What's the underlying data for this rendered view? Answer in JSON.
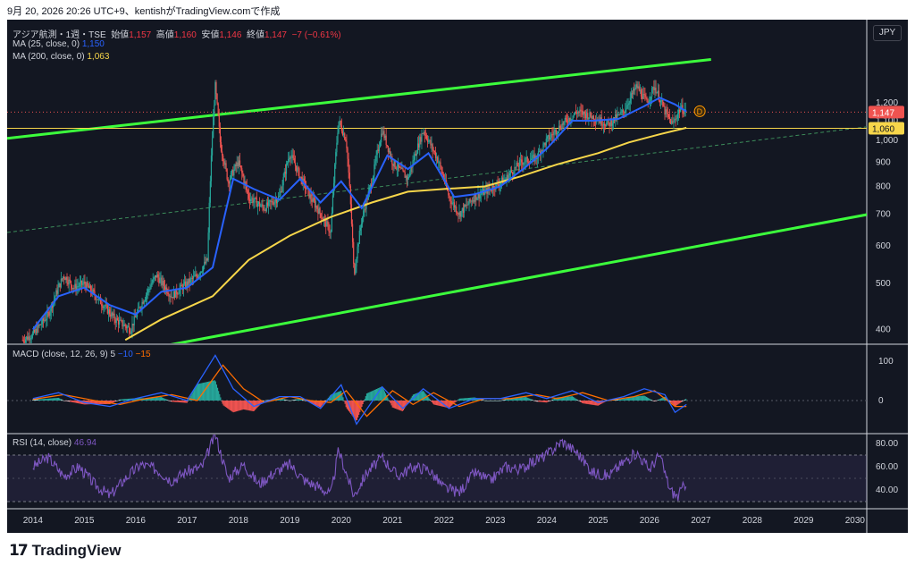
{
  "header": {
    "timestamp_text": "9月 20, 2026 20:26 UTC+9、kentishがTradingView.comで作成"
  },
  "symbol": {
    "name": "アジア航測・1週・TSE",
    "open_label": "始値",
    "open": "1,157",
    "high_label": "高値",
    "high": "1,160",
    "low_label": "安値",
    "low": "1,146",
    "close_label": "終値",
    "close": "1,147",
    "change": "−7 (−0.61%)"
  },
  "legend": {
    "ma25_label": "MA (25, close, 0)",
    "ma25_value": "1,150",
    "ma200_label": "MA (200, close, 0)",
    "ma200_value": "1,063",
    "macd_label": "MACD (close, 12, 26, 9)",
    "macd_hist": "5",
    "macd_line": "−10",
    "macd_signal": "−15",
    "rsi_label": "RSI (14, close)",
    "rsi_value": "46.94"
  },
  "currency_button": "JPY",
  "price_tags": {
    "last": "1,147",
    "ma200": "1,060"
  },
  "event_marker": "D",
  "colors": {
    "background": "#131722",
    "up": "#26a69a",
    "down": "#ef5350",
    "ma25": "#2962ff",
    "ma200": "#f7d64a",
    "channel": "#3cff3c",
    "macd": "#2962ff",
    "signal": "#ff6d00",
    "rsi": "#7e57c2"
  },
  "chart_data": {
    "type": "candlestick",
    "x_ticks": [
      "2014",
      "2015",
      "2016",
      "2017",
      "2018",
      "2019",
      "2020",
      "2021",
      "2022",
      "2023",
      "2024",
      "2025",
      "2026",
      "2027",
      "2028",
      "2029",
      "2030"
    ],
    "y_ticks": [
      "1,200",
      "1,100",
      "1,000",
      "900",
      "800",
      "700",
      "600",
      "500",
      "400"
    ],
    "y_scale": "log",
    "price_series": [
      {
        "t": 2013.8,
        "p": 380
      },
      {
        "t": 2014.0,
        "p": 390
      },
      {
        "t": 2014.3,
        "p": 430
      },
      {
        "t": 2014.6,
        "p": 520
      },
      {
        "t": 2014.8,
        "p": 490
      },
      {
        "t": 2015.0,
        "p": 500
      },
      {
        "t": 2015.3,
        "p": 460
      },
      {
        "t": 2015.6,
        "p": 420
      },
      {
        "t": 2015.9,
        "p": 400
      },
      {
        "t": 2016.1,
        "p": 450
      },
      {
        "t": 2016.4,
        "p": 520
      },
      {
        "t": 2016.7,
        "p": 470
      },
      {
        "t": 2016.9,
        "p": 490
      },
      {
        "t": 2017.2,
        "p": 520
      },
      {
        "t": 2017.4,
        "p": 560
      },
      {
        "t": 2017.55,
        "p": 1300
      },
      {
        "t": 2017.65,
        "p": 980
      },
      {
        "t": 2017.8,
        "p": 820
      },
      {
        "t": 2018.0,
        "p": 900
      },
      {
        "t": 2018.2,
        "p": 760
      },
      {
        "t": 2018.5,
        "p": 720
      },
      {
        "t": 2018.8,
        "p": 760
      },
      {
        "t": 2019.0,
        "p": 940
      },
      {
        "t": 2019.2,
        "p": 840
      },
      {
        "t": 2019.4,
        "p": 760
      },
      {
        "t": 2019.6,
        "p": 700
      },
      {
        "t": 2019.8,
        "p": 640
      },
      {
        "t": 2019.95,
        "p": 1100
      },
      {
        "t": 2020.1,
        "p": 1000
      },
      {
        "t": 2020.25,
        "p": 520
      },
      {
        "t": 2020.4,
        "p": 680
      },
      {
        "t": 2020.6,
        "p": 820
      },
      {
        "t": 2020.8,
        "p": 1050
      },
      {
        "t": 2021.0,
        "p": 900
      },
      {
        "t": 2021.3,
        "p": 830
      },
      {
        "t": 2021.6,
        "p": 1050
      },
      {
        "t": 2021.9,
        "p": 900
      },
      {
        "t": 2022.1,
        "p": 760
      },
      {
        "t": 2022.3,
        "p": 700
      },
      {
        "t": 2022.6,
        "p": 760
      },
      {
        "t": 2022.9,
        "p": 790
      },
      {
        "t": 2023.2,
        "p": 830
      },
      {
        "t": 2023.5,
        "p": 900
      },
      {
        "t": 2023.8,
        "p": 920
      },
      {
        "t": 2024.0,
        "p": 1000
      },
      {
        "t": 2024.3,
        "p": 1080
      },
      {
        "t": 2024.6,
        "p": 1150
      },
      {
        "t": 2024.9,
        "p": 1120
      },
      {
        "t": 2025.2,
        "p": 1080
      },
      {
        "t": 2025.5,
        "p": 1150
      },
      {
        "t": 2025.75,
        "p": 1300
      },
      {
        "t": 2025.95,
        "p": 1200
      },
      {
        "t": 2026.1,
        "p": 1300
      },
      {
        "t": 2026.3,
        "p": 1150
      },
      {
        "t": 2026.45,
        "p": 1080
      },
      {
        "t": 2026.6,
        "p": 1170
      },
      {
        "t": 2026.72,
        "p": 1147
      }
    ],
    "ma25_series": [
      {
        "t": 2014.0,
        "p": 400
      },
      {
        "t": 2014.5,
        "p": 470
      },
      {
        "t": 2015.0,
        "p": 490
      },
      {
        "t": 2015.5,
        "p": 450
      },
      {
        "t": 2016.0,
        "p": 430
      },
      {
        "t": 2016.5,
        "p": 480
      },
      {
        "t": 2017.0,
        "p": 490
      },
      {
        "t": 2017.5,
        "p": 540
      },
      {
        "t": 2017.9,
        "p": 830
      },
      {
        "t": 2018.3,
        "p": 790
      },
      {
        "t": 2018.8,
        "p": 750
      },
      {
        "t": 2019.2,
        "p": 830
      },
      {
        "t": 2019.6,
        "p": 740
      },
      {
        "t": 2020.0,
        "p": 820
      },
      {
        "t": 2020.4,
        "p": 720
      },
      {
        "t": 2020.9,
        "p": 930
      },
      {
        "t": 2021.3,
        "p": 870
      },
      {
        "t": 2021.7,
        "p": 940
      },
      {
        "t": 2022.2,
        "p": 760
      },
      {
        "t": 2022.6,
        "p": 770
      },
      {
        "t": 2023.1,
        "p": 800
      },
      {
        "t": 2023.6,
        "p": 880
      },
      {
        "t": 2024.0,
        "p": 960
      },
      {
        "t": 2024.5,
        "p": 1100
      },
      {
        "t": 2024.9,
        "p": 1100
      },
      {
        "t": 2025.4,
        "p": 1110
      },
      {
        "t": 2025.9,
        "p": 1180
      },
      {
        "t": 2026.2,
        "p": 1230
      },
      {
        "t": 2026.5,
        "p": 1190
      },
      {
        "t": 2026.72,
        "p": 1150
      }
    ],
    "ma200_series": [
      {
        "t": 2015.8,
        "p": 380
      },
      {
        "t": 2016.5,
        "p": 420
      },
      {
        "t": 2017.5,
        "p": 470
      },
      {
        "t": 2018.2,
        "p": 560
      },
      {
        "t": 2019.0,
        "p": 630
      },
      {
        "t": 2019.8,
        "p": 690
      },
      {
        "t": 2020.6,
        "p": 740
      },
      {
        "t": 2021.3,
        "p": 780
      },
      {
        "t": 2022.0,
        "p": 790
      },
      {
        "t": 2022.8,
        "p": 800
      },
      {
        "t": 2023.5,
        "p": 840
      },
      {
        "t": 2024.2,
        "p": 890
      },
      {
        "t": 2025.0,
        "p": 940
      },
      {
        "t": 2025.6,
        "p": 990
      },
      {
        "t": 2026.2,
        "p": 1030
      },
      {
        "t": 2026.72,
        "p": 1063
      }
    ],
    "channel_upper": [
      {
        "t": 2013.5,
        "p": 1010
      },
      {
        "t": 2027.2,
        "p": 1480
      }
    ],
    "channel_lower": [
      {
        "t": 2016.0,
        "p": 360
      },
      {
        "t": 2030.3,
        "p": 700
      }
    ],
    "channel_mid": [
      {
        "t": 2013.5,
        "p": 640
      },
      {
        "t": 2030.3,
        "p": 1070
      }
    ],
    "horizontal_line": 1060,
    "macd": {
      "ticks": [
        "100",
        "0"
      ],
      "line": [
        {
          "t": 2014.0,
          "v": 5
        },
        {
          "t": 2014.5,
          "v": 20
        },
        {
          "t": 2015.0,
          "v": -5
        },
        {
          "t": 2015.5,
          "v": -15
        },
        {
          "t": 2016.0,
          "v": 5
        },
        {
          "t": 2016.5,
          "v": 20
        },
        {
          "t": 2017.0,
          "v": 0
        },
        {
          "t": 2017.55,
          "v": 115
        },
        {
          "t": 2017.9,
          "v": 30
        },
        {
          "t": 2018.3,
          "v": -15
        },
        {
          "t": 2018.8,
          "v": 10
        },
        {
          "t": 2019.2,
          "v": 10
        },
        {
          "t": 2019.6,
          "v": -20
        },
        {
          "t": 2020.0,
          "v": 40
        },
        {
          "t": 2020.3,
          "v": -60
        },
        {
          "t": 2020.8,
          "v": 35
        },
        {
          "t": 2021.2,
          "v": -20
        },
        {
          "t": 2021.6,
          "v": 30
        },
        {
          "t": 2022.1,
          "v": -20
        },
        {
          "t": 2022.6,
          "v": 5
        },
        {
          "t": 2023.1,
          "v": 5
        },
        {
          "t": 2023.6,
          "v": 20
        },
        {
          "t": 2024.0,
          "v": 5
        },
        {
          "t": 2024.5,
          "v": 25
        },
        {
          "t": 2025.0,
          "v": -5
        },
        {
          "t": 2025.5,
          "v": 10
        },
        {
          "t": 2025.9,
          "v": 30
        },
        {
          "t": 2026.3,
          "v": 15
        },
        {
          "t": 2026.5,
          "v": -30
        },
        {
          "t": 2026.72,
          "v": -10
        }
      ],
      "signal": [
        {
          "t": 2014.0,
          "v": 3
        },
        {
          "t": 2014.6,
          "v": 15
        },
        {
          "t": 2015.2,
          "v": 0
        },
        {
          "t": 2015.7,
          "v": -10
        },
        {
          "t": 2016.2,
          "v": 5
        },
        {
          "t": 2016.7,
          "v": 15
        },
        {
          "t": 2017.2,
          "v": 0
        },
        {
          "t": 2017.7,
          "v": 90
        },
        {
          "t": 2018.1,
          "v": 30
        },
        {
          "t": 2018.5,
          "v": -5
        },
        {
          "t": 2019.0,
          "v": 10
        },
        {
          "t": 2019.4,
          "v": 0
        },
        {
          "t": 2019.8,
          "v": -5
        },
        {
          "t": 2020.1,
          "v": 25
        },
        {
          "t": 2020.5,
          "v": -40
        },
        {
          "t": 2021.0,
          "v": 25
        },
        {
          "t": 2021.4,
          "v": -10
        },
        {
          "t": 2021.8,
          "v": 20
        },
        {
          "t": 2022.3,
          "v": -15
        },
        {
          "t": 2022.8,
          "v": 5
        },
        {
          "t": 2023.3,
          "v": 5
        },
        {
          "t": 2023.8,
          "v": 15
        },
        {
          "t": 2024.2,
          "v": 5
        },
        {
          "t": 2024.7,
          "v": 20
        },
        {
          "t": 2025.2,
          "v": 0
        },
        {
          "t": 2025.7,
          "v": 10
        },
        {
          "t": 2026.1,
          "v": 25
        },
        {
          "t": 2026.5,
          "v": -15
        },
        {
          "t": 2026.72,
          "v": -15
        }
      ]
    },
    "rsi": {
      "ticks": [
        "80.00",
        "60.00",
        "40.00"
      ],
      "band": [
        30,
        70
      ],
      "series": [
        {
          "t": 2014.0,
          "v": 60
        },
        {
          "t": 2014.3,
          "v": 68
        },
        {
          "t": 2014.6,
          "v": 52
        },
        {
          "t": 2014.9,
          "v": 60
        },
        {
          "t": 2015.2,
          "v": 45
        },
        {
          "t": 2015.5,
          "v": 35
        },
        {
          "t": 2015.8,
          "v": 50
        },
        {
          "t": 2016.1,
          "v": 62
        },
        {
          "t": 2016.4,
          "v": 58
        },
        {
          "t": 2016.7,
          "v": 48
        },
        {
          "t": 2017.0,
          "v": 56
        },
        {
          "t": 2017.3,
          "v": 60
        },
        {
          "t": 2017.55,
          "v": 88
        },
        {
          "t": 2017.8,
          "v": 50
        },
        {
          "t": 2018.1,
          "v": 62
        },
        {
          "t": 2018.4,
          "v": 45
        },
        {
          "t": 2018.7,
          "v": 55
        },
        {
          "t": 2019.0,
          "v": 62
        },
        {
          "t": 2019.3,
          "v": 48
        },
        {
          "t": 2019.6,
          "v": 42
        },
        {
          "t": 2019.8,
          "v": 36
        },
        {
          "t": 2019.95,
          "v": 74
        },
        {
          "t": 2020.25,
          "v": 35
        },
        {
          "t": 2020.5,
          "v": 55
        },
        {
          "t": 2020.8,
          "v": 68
        },
        {
          "t": 2021.1,
          "v": 52
        },
        {
          "t": 2021.4,
          "v": 60
        },
        {
          "t": 2021.7,
          "v": 58
        },
        {
          "t": 2022.0,
          "v": 42
        },
        {
          "t": 2022.3,
          "v": 38
        },
        {
          "t": 2022.6,
          "v": 55
        },
        {
          "t": 2022.9,
          "v": 48
        },
        {
          "t": 2023.2,
          "v": 60
        },
        {
          "t": 2023.5,
          "v": 58
        },
        {
          "t": 2023.8,
          "v": 66
        },
        {
          "t": 2024.0,
          "v": 70
        },
        {
          "t": 2024.3,
          "v": 82
        },
        {
          "t": 2024.6,
          "v": 72
        },
        {
          "t": 2024.9,
          "v": 55
        },
        {
          "t": 2025.2,
          "v": 52
        },
        {
          "t": 2025.5,
          "v": 64
        },
        {
          "t": 2025.75,
          "v": 72
        },
        {
          "t": 2026.0,
          "v": 58
        },
        {
          "t": 2026.2,
          "v": 70
        },
        {
          "t": 2026.4,
          "v": 40
        },
        {
          "t": 2026.55,
          "v": 34
        },
        {
          "t": 2026.72,
          "v": 47
        }
      ]
    }
  }
}
